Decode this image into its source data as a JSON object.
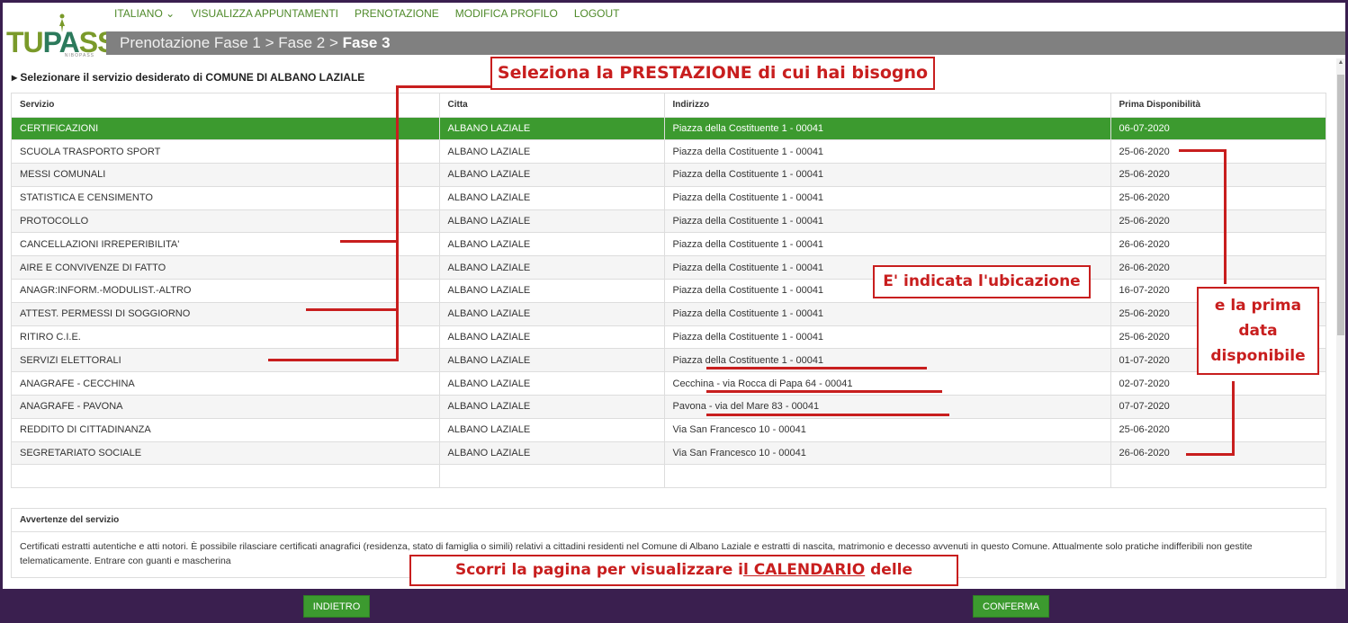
{
  "logo": {
    "text_a": "TU",
    "text_b": "PA",
    "text_c": "SSI",
    "sub": "NIBOPASS"
  },
  "nav": [
    "ITALIANO ⌄",
    "VISUALIZZA APPUNTAMENTI",
    "PRENOTAZIONE",
    "MODIFICA PROFILO",
    "LOGOUT"
  ],
  "breadcrumb": {
    "prefix": "Prenotazione Fase 1 > Fase 2 > ",
    "current": "Fase 3"
  },
  "section_title": "▸ Selezionare il servizio desiderato di COMUNE DI ALBANO LAZIALE",
  "table": {
    "headers": [
      "Servizio",
      "Citta",
      "Indirizzo",
      "Prima Disponibilità"
    ],
    "rows": [
      [
        "CERTIFICAZIONI",
        "ALBANO LAZIALE",
        "Piazza della Costituente 1 - 00041",
        "06-07-2020"
      ],
      [
        "SCUOLA TRASPORTO SPORT",
        "ALBANO LAZIALE",
        "Piazza della Costituente 1 - 00041",
        "25-06-2020"
      ],
      [
        "MESSI COMUNALI",
        "ALBANO LAZIALE",
        "Piazza della Costituente 1 - 00041",
        "25-06-2020"
      ],
      [
        "STATISTICA E CENSIMENTO",
        "ALBANO LAZIALE",
        "Piazza della Costituente 1 - 00041",
        "25-06-2020"
      ],
      [
        "PROTOCOLLO",
        "ALBANO LAZIALE",
        "Piazza della Costituente 1 - 00041",
        "25-06-2020"
      ],
      [
        "CANCELLAZIONI IRREPERIBILITA'",
        "ALBANO LAZIALE",
        "Piazza della Costituente 1 - 00041",
        "26-06-2020"
      ],
      [
        "AIRE E CONVIVENZE DI FATTO",
        "ALBANO LAZIALE",
        "Piazza della Costituente 1 - 00041",
        "26-06-2020"
      ],
      [
        "ANAGR:INFORM.-MODULIST.-ALTRO",
        "ALBANO LAZIALE",
        "Piazza della Costituente 1 - 00041",
        "16-07-2020"
      ],
      [
        "ATTEST. PERMESSI DI SOGGIORNO",
        "ALBANO LAZIALE",
        "Piazza della Costituente 1 - 00041",
        "25-06-2020"
      ],
      [
        "RITIRO C.I.E.",
        "ALBANO LAZIALE",
        "Piazza della Costituente 1 - 00041",
        "25-06-2020"
      ],
      [
        "SERVIZI ELETTORALI",
        "ALBANO LAZIALE",
        "Piazza della Costituente 1 - 00041",
        "01-07-2020"
      ],
      [
        "ANAGRAFE - CECCHINA",
        "ALBANO LAZIALE",
        "Cecchina - via Rocca di Papa 64 - 00041",
        "02-07-2020"
      ],
      [
        "ANAGRAFE - PAVONA",
        "ALBANO LAZIALE",
        "Pavona - via del Mare 83 - 00041",
        "07-07-2020"
      ],
      [
        "REDDITO DI CITTADINANZA",
        "ALBANO LAZIALE",
        "Via San Francesco 10 - 00041",
        "25-06-2020"
      ],
      [
        "SEGRETARIATO SOCIALE",
        "ALBANO LAZIALE",
        "Via San Francesco 10 - 00041",
        "26-06-2020"
      ]
    ],
    "selected_index": 0
  },
  "notice": {
    "title": "Avvertenze del servizio",
    "body": "Certificati estratti autentiche e atti notori. È possibile rilasciare certificati anagrafici (residenza, stato di famiglia o simili) relativi a cittadini residenti nel Comune di Albano Laziale e estratti di nascita, matrimonio e decesso avvenuti in questo Comune. Attualmente solo pratiche indifferibili non gestite telematicamente. Entrare con guanti e mascherina"
  },
  "buttons": {
    "back": "INDIETRO",
    "confirm": "CONFERMA"
  },
  "annotations": {
    "a1": "Seleziona la PRESTAZIONE di cui hai bisogno",
    "a2": "E' indicata l'ubicazione",
    "a3_l1": "e la prima",
    "a3_l2": "data",
    "a3_l3": "disponibile",
    "a4_pre": "Scorri la pagina per visualizzare i",
    "a4_mid": "l CALENDARIO",
    "a4_post": " delle disponibilità"
  },
  "colors": {
    "accent": "#3c9a2f",
    "annotation": "#c81e1e",
    "background": "#3a1f4f"
  }
}
